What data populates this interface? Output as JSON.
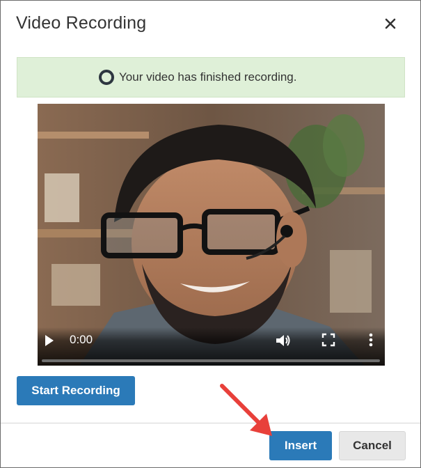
{
  "dialog": {
    "title": "Video Recording",
    "close_icon": "close-icon"
  },
  "alert": {
    "icon": "circle-status-icon",
    "message": "Your video has finished recording."
  },
  "player": {
    "time": "0:00",
    "progress_fraction": 0,
    "icons": [
      "play-icon",
      "volume-icon",
      "fullscreen-icon",
      "more-options-icon"
    ]
  },
  "buttons": {
    "start_recording": "Start Recording",
    "insert": "Insert",
    "cancel": "Cancel"
  },
  "colors": {
    "primary": "#2b7ab8",
    "alert_bg": "#dff0d8",
    "annotation_arrow": "#e8403a"
  }
}
